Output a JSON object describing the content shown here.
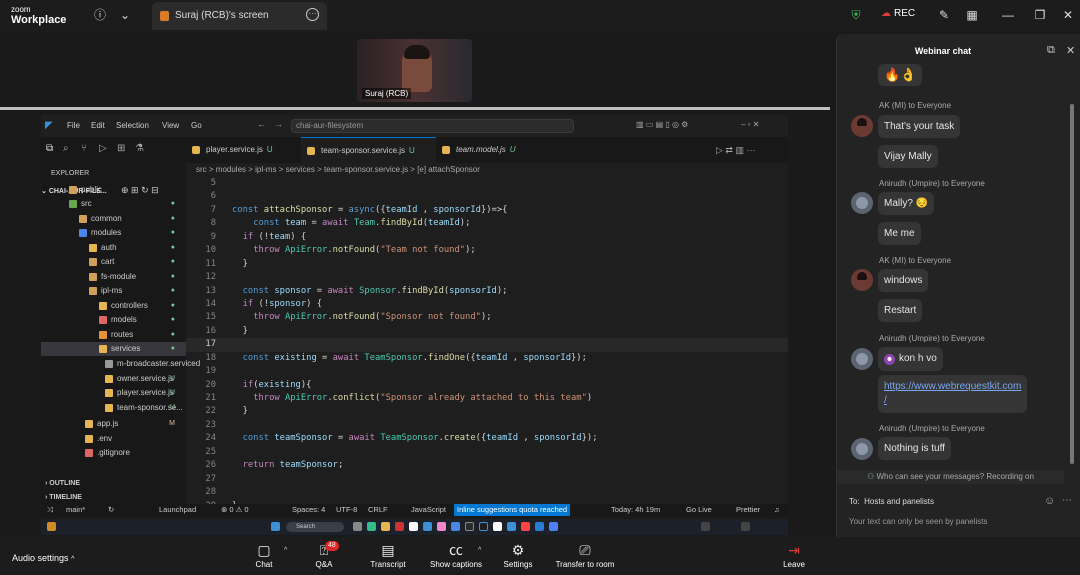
{
  "app": {
    "logo_line1": "zoom",
    "logo_line2": "Workplace"
  },
  "topbar": {
    "share_tab_label": "Suraj (RCB)'s screen",
    "rec_label": "REC"
  },
  "video": {
    "name": "Suraj (RCB)"
  },
  "vscode": {
    "menu": [
      "File",
      "Edit",
      "Selection",
      "View",
      "Go"
    ],
    "search": "chai-aur-filesystem",
    "tabs": [
      {
        "label": "player.service.js",
        "mark": "U"
      },
      {
        "label": "team-sponsor.service.js",
        "mark": "U"
      },
      {
        "label": "team.model.js",
        "mark": "U"
      }
    ],
    "breadcrumb": "src > modules > ipl-ms > services > team-sponsor.service.js > [e] attachSponsor",
    "explorer_label": "EXPLORER",
    "project_label": "CHAI-AUR-FILE...",
    "tree": [
      {
        "label": "public",
        "color": "#cfa05a"
      },
      {
        "label": "src",
        "color": "#6aa84f"
      },
      {
        "label": "common",
        "color": "#cfa05a"
      },
      {
        "label": "modules",
        "color": "#4a86e8"
      },
      {
        "label": "auth",
        "color": "#e6b450"
      },
      {
        "label": "cart",
        "color": "#cfa05a"
      },
      {
        "label": "fs-module",
        "color": "#cfa05a"
      },
      {
        "label": "ipl-ms",
        "color": "#cfa05a"
      },
      {
        "label": "controllers",
        "color": "#e6b450"
      },
      {
        "label": "models",
        "color": "#e06666"
      },
      {
        "label": "routes",
        "color": "#e69138"
      },
      {
        "label": "services",
        "color": "#e6b450"
      },
      {
        "label": "m-broadcaster.serviced",
        "color": "#999999"
      },
      {
        "label": "owner.service.js",
        "color": "#e6b450"
      },
      {
        "label": "player.service.js",
        "color": "#e6b450"
      },
      {
        "label": "team-sponsor.se...",
        "color": "#e6b450"
      },
      {
        "label": "app.js",
        "color": "#e6b450"
      },
      {
        "label": ".env",
        "color": "#e6b450"
      },
      {
        "label": ".gitignore",
        "color": "#e06666"
      }
    ],
    "outline": "OUTLINE",
    "timeline": "TIMELINE",
    "line_numbers": [
      "5",
      "6",
      "7",
      "8",
      "9",
      "10",
      "11",
      "12",
      "13",
      "14",
      "15",
      "16",
      "17",
      "18",
      "19",
      "20",
      "21",
      "22",
      "23",
      "24",
      "25",
      "26",
      "27",
      "28",
      "29"
    ],
    "code_lines": [
      "",
      "",
      "const attachSponsor = async({teamId , sponsorId})=>{",
      "    const team = await Team.findById(teamId);",
      "  if (!team) {",
      "    throw ApiError.notFound(\"Team not found\");",
      "  }",
      "",
      "  const sponsor = await Sponsor.findById(sponsorId);",
      "  if (!sponsor) {",
      "    throw ApiError.notFound(\"Sponsor not found\");",
      "  }",
      "",
      "  const existing = await TeamSponsor.findOne({teamId , sponsorId});",
      "",
      "  if(existing){",
      "    throw ApiError.conflict(\"Sponsor already attached to this team\")",
      "  }",
      "",
      "  const teamSponsor = await TeamSponsor.create({teamId , sponsorId});",
      "",
      "  return teamSponsor;",
      "",
      "",
      "}"
    ],
    "status": {
      "branch": "main*",
      "launchpad": "Launchpad",
      "problems": "⊗ 0 ⚠ 0",
      "spaces": "Spaces: 4",
      "encoding": "UTF-8",
      "eol": "CRLF",
      "language": "JavaScript",
      "inline": "Inline suggestions quota reached",
      "today": "Today: 4h 19m",
      "golive": "Go Live",
      "prettier": "Prettier"
    }
  },
  "chat": {
    "title": "Webinar chat",
    "messages": [
      {
        "sender": "AK (MI) to Everyone",
        "texts": [
          "That's your task",
          "Vijay Mally"
        ]
      },
      {
        "sender": "Anirudh (Umpire) to Everyone",
        "texts": [
          "Mally? 😔",
          "Me me"
        ]
      },
      {
        "sender": "AK (MI) to Everyone",
        "texts": [
          "windows",
          "Restart"
        ]
      },
      {
        "sender": "Anirudh (Umpire) to Everyone",
        "texts": [
          "kon h vo",
          "https://www.webrequestkit.com/"
        ]
      },
      {
        "sender": "Anirudh (Umpire) to Everyone",
        "texts": [
          "Nothing is tuff"
        ]
      }
    ],
    "link_line1": "https://www.webrequestkit.com",
    "link_line2": "/",
    "notice": "Who can see your messages? Recording on",
    "to_label": "To:",
    "to_value": "Hosts and panelists",
    "hint": "Your text can only be seen by panelists"
  },
  "toolbar": {
    "audio_settings": "Audio settings",
    "chat": "Chat",
    "qa": "Q&A",
    "qa_badge": "48",
    "transcript": "Transcript",
    "captions": "Show captions",
    "settings": "Settings",
    "transfer": "Transfer to room",
    "leave": "Leave"
  }
}
